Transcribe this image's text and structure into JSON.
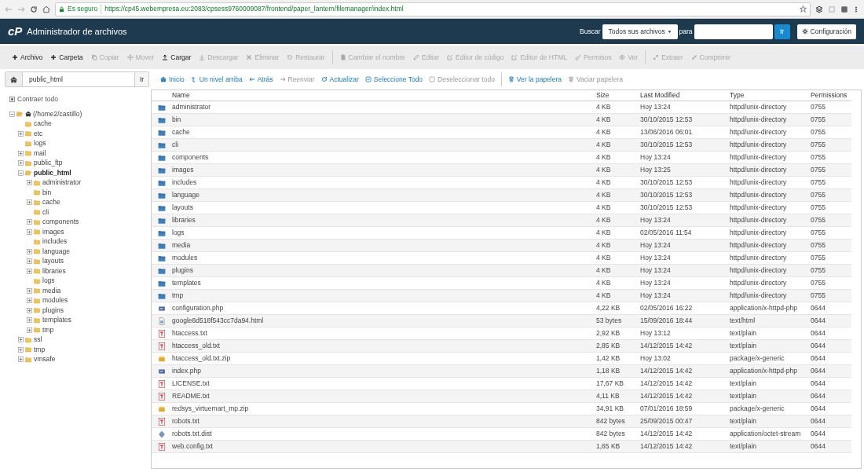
{
  "browser": {
    "secure_label": "Es seguro",
    "url": "https://cp45.webempresa.eu:2083/cpsess9760009087/frontend/paper_lantern/filemanager/index.html"
  },
  "header": {
    "logo": "cP",
    "title": "Administrador de archivos",
    "search_label": "Buscar",
    "scope": "Todos sus archivos",
    "for_label": "para",
    "go_button": "Ir",
    "settings_button": "Configuración"
  },
  "toolbar": {
    "groups": [
      [
        {
          "label": "Archivo",
          "disabled": false
        },
        {
          "label": "Carpeta",
          "disabled": false
        },
        {
          "label": "Copiar",
          "disabled": true
        },
        {
          "label": "Mover",
          "disabled": true
        },
        {
          "label": "Cargar",
          "disabled": false
        },
        {
          "label": "Descargar",
          "disabled": true
        },
        {
          "label": "Eliminar",
          "disabled": true
        },
        {
          "label": "Restaurar",
          "disabled": true
        }
      ],
      [
        {
          "label": "Cambiar el nombre",
          "disabled": true
        },
        {
          "label": "Editar",
          "disabled": true
        },
        {
          "label": "Editor de código",
          "disabled": true
        },
        {
          "label": "Editor de HTML",
          "disabled": true
        },
        {
          "label": "Permisos",
          "disabled": true
        },
        {
          "label": "Ver",
          "disabled": true
        }
      ],
      [
        {
          "label": "Extraer",
          "disabled": true
        },
        {
          "label": "Comprimir",
          "disabled": true
        }
      ]
    ]
  },
  "location": {
    "value": "public_html",
    "go_button": "Ir"
  },
  "nav": {
    "groups": [
      [
        {
          "label": "Inicio",
          "disabled": false
        },
        {
          "label": "Un nivel arriba",
          "disabled": false
        },
        {
          "label": "Atrás",
          "disabled": false
        },
        {
          "label": "Reenviar",
          "disabled": true
        },
        {
          "label": "Actualizar",
          "disabled": false
        },
        {
          "label": "Seleccione Todo",
          "disabled": false
        },
        {
          "label": "Deseleccionar todo",
          "disabled": true
        }
      ],
      [
        {
          "label": "Ver la papelera",
          "disabled": false
        },
        {
          "label": "Vaciar papelera",
          "disabled": true
        }
      ]
    ]
  },
  "tree": {
    "collapse_all": "Contraer todo",
    "root": {
      "label": "(/home2/castillo)",
      "kind": "branch",
      "expanded": true,
      "selected": false,
      "children": [
        {
          "label": "cache",
          "kind": "leaf",
          "expanded": false,
          "selected": false
        },
        {
          "label": "etc",
          "kind": "branch",
          "expanded": false,
          "selected": false
        },
        {
          "label": "logs",
          "kind": "leaf",
          "expanded": false,
          "selected": false
        },
        {
          "label": "mail",
          "kind": "branch",
          "expanded": false,
          "selected": false
        },
        {
          "label": "public_ftp",
          "kind": "branch",
          "expanded": false,
          "selected": false
        },
        {
          "label": "public_html",
          "kind": "branch",
          "expanded": true,
          "selected": true,
          "children": [
            {
              "label": "administrator",
              "kind": "branch",
              "expanded": false,
              "selected": false
            },
            {
              "label": "bin",
              "kind": "leaf",
              "expanded": false,
              "selected": false
            },
            {
              "label": "cache",
              "kind": "branch",
              "expanded": false,
              "selected": false
            },
            {
              "label": "cli",
              "kind": "leaf",
              "expanded": false,
              "selected": false
            },
            {
              "label": "components",
              "kind": "branch",
              "expanded": false,
              "selected": false
            },
            {
              "label": "images",
              "kind": "branch",
              "expanded": false,
              "selected": false
            },
            {
              "label": "includes",
              "kind": "leaf",
              "expanded": false,
              "selected": false
            },
            {
              "label": "language",
              "kind": "branch",
              "expanded": false,
              "selected": false
            },
            {
              "label": "layouts",
              "kind": "branch",
              "expanded": false,
              "selected": false
            },
            {
              "label": "libraries",
              "kind": "branch",
              "expanded": false,
              "selected": false
            },
            {
              "label": "logs",
              "kind": "leaf",
              "expanded": false,
              "selected": false
            },
            {
              "label": "media",
              "kind": "branch",
              "expanded": false,
              "selected": false
            },
            {
              "label": "modules",
              "kind": "branch",
              "expanded": false,
              "selected": false
            },
            {
              "label": "plugins",
              "kind": "branch",
              "expanded": false,
              "selected": false
            },
            {
              "label": "templates",
              "kind": "branch",
              "expanded": false,
              "selected": false
            },
            {
              "label": "tmp",
              "kind": "branch",
              "expanded": false,
              "selected": false
            }
          ]
        },
        {
          "label": "ssl",
          "kind": "branch",
          "expanded": false,
          "selected": false
        },
        {
          "label": "tmp",
          "kind": "branch",
          "expanded": false,
          "selected": false
        },
        {
          "label": "vmsafe",
          "kind": "branch",
          "expanded": false,
          "selected": false
        }
      ]
    }
  },
  "table": {
    "columns": [
      "Name",
      "Size",
      "Last Modified",
      "Type",
      "Permissions"
    ],
    "rows": [
      {
        "kind": "folder",
        "name": "administrator",
        "size": "4 KB",
        "modified": "Hoy 13:24",
        "type": "httpd/unix-directory",
        "permissions": "0755"
      },
      {
        "kind": "folder",
        "name": "bin",
        "size": "4 KB",
        "modified": "30/10/2015 12:53",
        "type": "httpd/unix-directory",
        "permissions": "0755"
      },
      {
        "kind": "folder",
        "name": "cache",
        "size": "4 KB",
        "modified": "13/06/2016 06:01",
        "type": "httpd/unix-directory",
        "permissions": "0755"
      },
      {
        "kind": "folder",
        "name": "cli",
        "size": "4 KB",
        "modified": "30/10/2015 12:53",
        "type": "httpd/unix-directory",
        "permissions": "0755"
      },
      {
        "kind": "folder",
        "name": "components",
        "size": "4 KB",
        "modified": "Hoy 13:24",
        "type": "httpd/unix-directory",
        "permissions": "0755"
      },
      {
        "kind": "folder",
        "name": "images",
        "size": "4 KB",
        "modified": "Hoy 13:25",
        "type": "httpd/unix-directory",
        "permissions": "0755"
      },
      {
        "kind": "folder",
        "name": "includes",
        "size": "4 KB",
        "modified": "30/10/2015 12:53",
        "type": "httpd/unix-directory",
        "permissions": "0755"
      },
      {
        "kind": "folder",
        "name": "language",
        "size": "4 KB",
        "modified": "30/10/2015 12:53",
        "type": "httpd/unix-directory",
        "permissions": "0755"
      },
      {
        "kind": "folder",
        "name": "layouts",
        "size": "4 KB",
        "modified": "30/10/2015 12:53",
        "type": "httpd/unix-directory",
        "permissions": "0755"
      },
      {
        "kind": "folder",
        "name": "libraries",
        "size": "4 KB",
        "modified": "Hoy 13:24",
        "type": "httpd/unix-directory",
        "permissions": "0755"
      },
      {
        "kind": "folder",
        "name": "logs",
        "size": "4 KB",
        "modified": "02/05/2016 11:54",
        "type": "httpd/unix-directory",
        "permissions": "0755"
      },
      {
        "kind": "folder",
        "name": "media",
        "size": "4 KB",
        "modified": "Hoy 13:24",
        "type": "httpd/unix-directory",
        "permissions": "0755"
      },
      {
        "kind": "folder",
        "name": "modules",
        "size": "4 KB",
        "modified": "Hoy 13:24",
        "type": "httpd/unix-directory",
        "permissions": "0755"
      },
      {
        "kind": "folder",
        "name": "plugins",
        "size": "4 KB",
        "modified": "Hoy 13:24",
        "type": "httpd/unix-directory",
        "permissions": "0755"
      },
      {
        "kind": "folder",
        "name": "templates",
        "size": "4 KB",
        "modified": "Hoy 13:24",
        "type": "httpd/unix-directory",
        "permissions": "0755"
      },
      {
        "kind": "folder",
        "name": "tmp",
        "size": "4 KB",
        "modified": "Hoy 13:24",
        "type": "httpd/unix-directory",
        "permissions": "0755"
      },
      {
        "kind": "php",
        "name": "configuration.php",
        "size": "4,22 KB",
        "modified": "02/05/2016 16:22",
        "type": "application/x-httpd-php",
        "permissions": "0644"
      },
      {
        "kind": "html",
        "name": "google8d518f543cc7da94.html",
        "size": "53 bytes",
        "modified": "15/09/2016 18:44",
        "type": "text/html",
        "permissions": "0644"
      },
      {
        "kind": "text",
        "name": "htaccess.txt",
        "size": "2,92 KB",
        "modified": "Hoy 13:12",
        "type": "text/plain",
        "permissions": "0644"
      },
      {
        "kind": "text",
        "name": "htaccess_old.txt",
        "size": "2,85 KB",
        "modified": "14/12/2015 14:42",
        "type": "text/plain",
        "permissions": "0644"
      },
      {
        "kind": "archive",
        "name": "htaccess_old.txt.zip",
        "size": "1,42 KB",
        "modified": "Hoy 13:02",
        "type": "package/x-generic",
        "permissions": "0644"
      },
      {
        "kind": "php",
        "name": "index.php",
        "size": "1,18 KB",
        "modified": "14/12/2015 14:42",
        "type": "application/x-httpd-php",
        "permissions": "0644"
      },
      {
        "kind": "text",
        "name": "LICENSE.txt",
        "size": "17,67 KB",
        "modified": "14/12/2015 14:42",
        "type": "text/plain",
        "permissions": "0644"
      },
      {
        "kind": "text",
        "name": "README.txt",
        "size": "4,11 KB",
        "modified": "14/12/2015 14:42",
        "type": "text/plain",
        "permissions": "0644"
      },
      {
        "kind": "archive",
        "name": "redsys_virtuemart_mp.zip",
        "size": "34,91 KB",
        "modified": "07/01/2016 18:59",
        "type": "package/x-generic",
        "permissions": "0644"
      },
      {
        "kind": "text",
        "name": "robots.txt",
        "size": "842 bytes",
        "modified": "25/09/2015 00:47",
        "type": "text/plain",
        "permissions": "0644"
      },
      {
        "kind": "binary",
        "name": "robots.txt.dist",
        "size": "842 bytes",
        "modified": "14/12/2015 14:42",
        "type": "application/octet-stream",
        "permissions": "0644"
      },
      {
        "kind": "text",
        "name": "web.config.txt",
        "size": "1,65 KB",
        "modified": "14/12/2015 14:42",
        "type": "text/plain",
        "permissions": "0644"
      }
    ]
  }
}
